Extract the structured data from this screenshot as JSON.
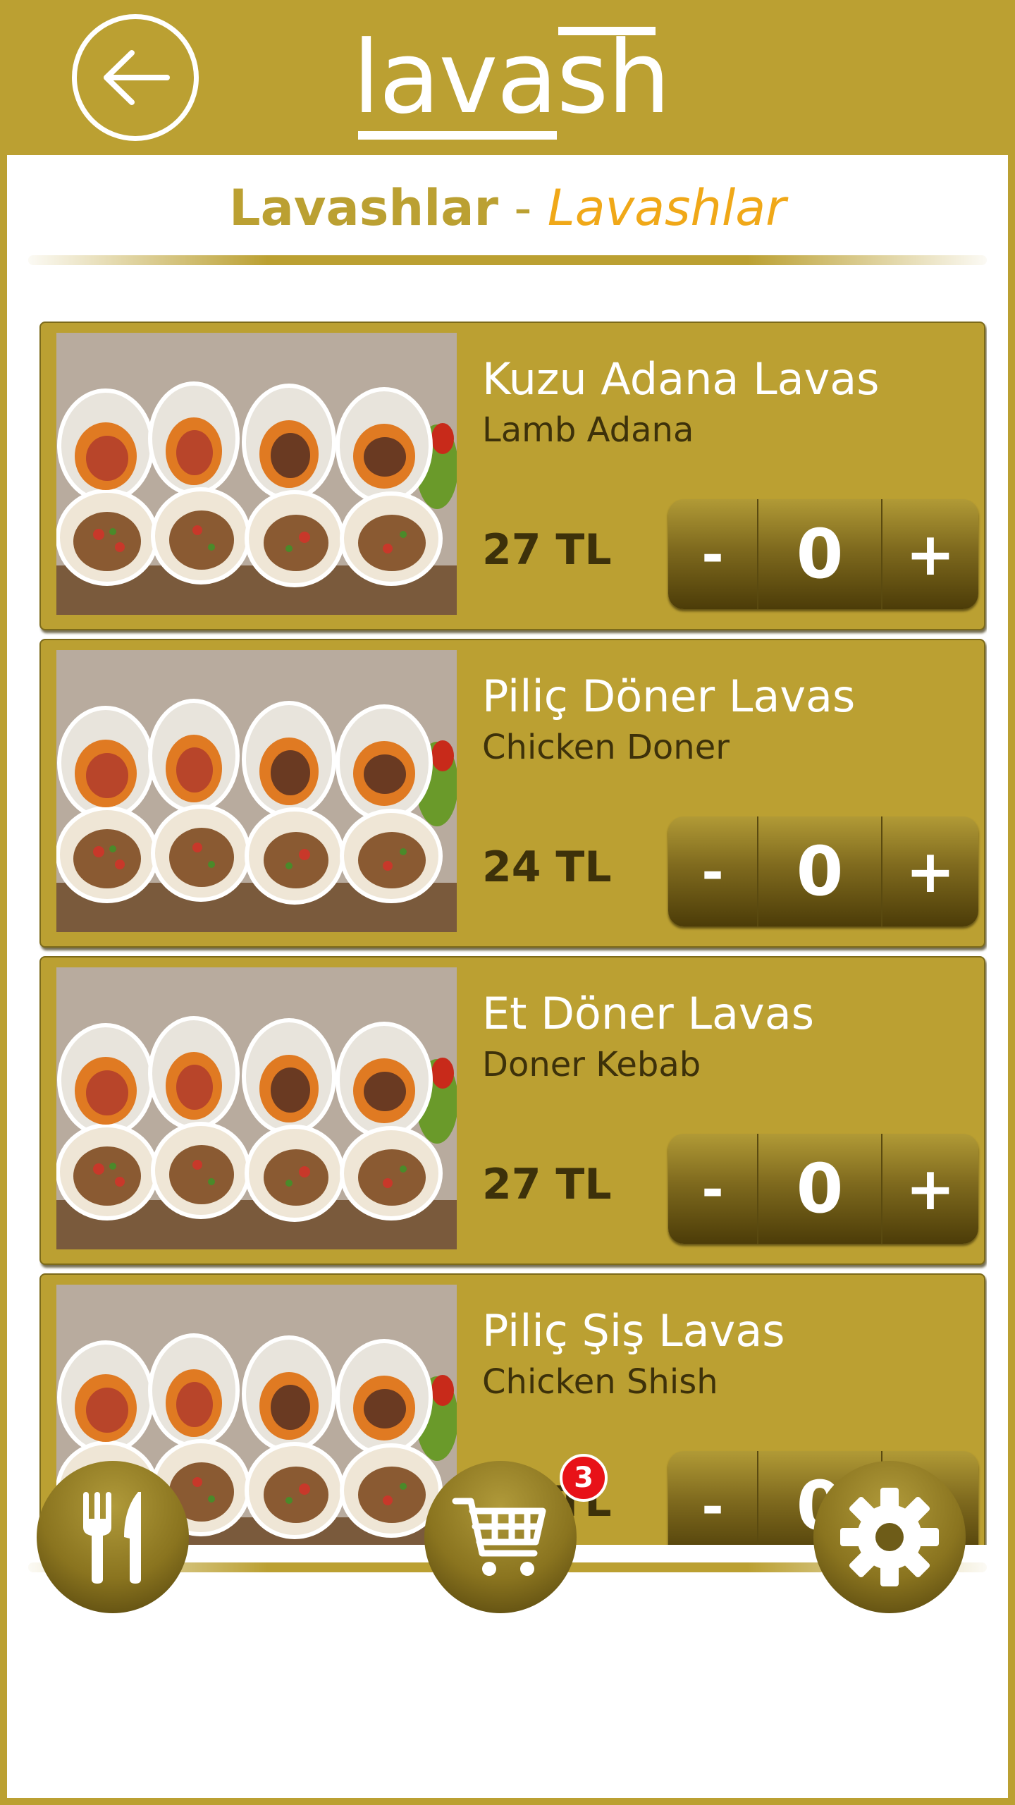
{
  "app": {
    "logo_text": "lavash",
    "accent_color": "#bba032",
    "secondary_color": "#f0a818"
  },
  "header": {
    "back_icon": "arrow-left-icon"
  },
  "category": {
    "title_primary": "Lavashlar",
    "separator": "-",
    "title_secondary": "Lavashlar"
  },
  "products": [
    {
      "name": "Kuzu Adana Lavas",
      "subtitle": "Lamb Adana",
      "price": "27 TL",
      "quantity": "0",
      "minus_label": "-",
      "plus_label": "+"
    },
    {
      "name": "Piliç Döner Lavas",
      "subtitle": "Chicken Doner",
      "price": "24 TL",
      "quantity": "0",
      "minus_label": "-",
      "plus_label": "+"
    },
    {
      "name": "Et Döner Lavas",
      "subtitle": "Doner Kebab",
      "price": "27 TL",
      "quantity": "0",
      "minus_label": "-",
      "plus_label": "+"
    },
    {
      "name": "Piliç Şiş Lavas",
      "subtitle": "Chicken Shish",
      "price": "25 TL",
      "quantity": "0",
      "minus_label": "-",
      "plus_label": "+"
    }
  ],
  "bottom_nav": {
    "menu_icon": "fork-knife-icon",
    "cart_icon": "shopping-cart-icon",
    "cart_count": "3",
    "settings_icon": "gear-icon"
  }
}
